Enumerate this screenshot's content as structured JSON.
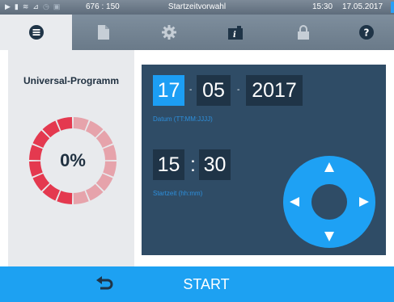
{
  "statusbar": {
    "counter": "676 : 150",
    "title": "Startzeitvorwahl",
    "time": "15:30",
    "date": "17.05.2017",
    "icons": [
      "play-icon",
      "file-icon",
      "heat-icon",
      "chart-icon",
      "clock-icon",
      "lock-icon"
    ]
  },
  "tabs": [
    {
      "name": "menu",
      "icon": "list-icon",
      "active": true
    },
    {
      "name": "documents",
      "icon": "document-icon",
      "active": false
    },
    {
      "name": "settings",
      "icon": "gear-icon",
      "active": false
    },
    {
      "name": "info",
      "icon": "info-icon",
      "active": false
    },
    {
      "name": "lock",
      "icon": "lock-icon",
      "active": false
    },
    {
      "name": "help",
      "icon": "help-icon",
      "active": false
    }
  ],
  "program": {
    "title": "Universal-Programm",
    "progress_text": "0%",
    "progress": 0
  },
  "date": {
    "day": "17",
    "month": "05",
    "year": "2017",
    "separator": "-",
    "hint": "Datum (TT:MM:JJJJ)"
  },
  "starttime": {
    "hour": "15",
    "colon": ":",
    "minute": "30",
    "hint": "Startzeit (hh:mm)"
  },
  "help_glyph": "?",
  "bottom": {
    "start_label": "START"
  },
  "colors": {
    "accent": "#1da1f2",
    "panel_dark": "#2f4c66",
    "ring_dark": "#e4394f",
    "ring_light": "#e6a3ab"
  }
}
